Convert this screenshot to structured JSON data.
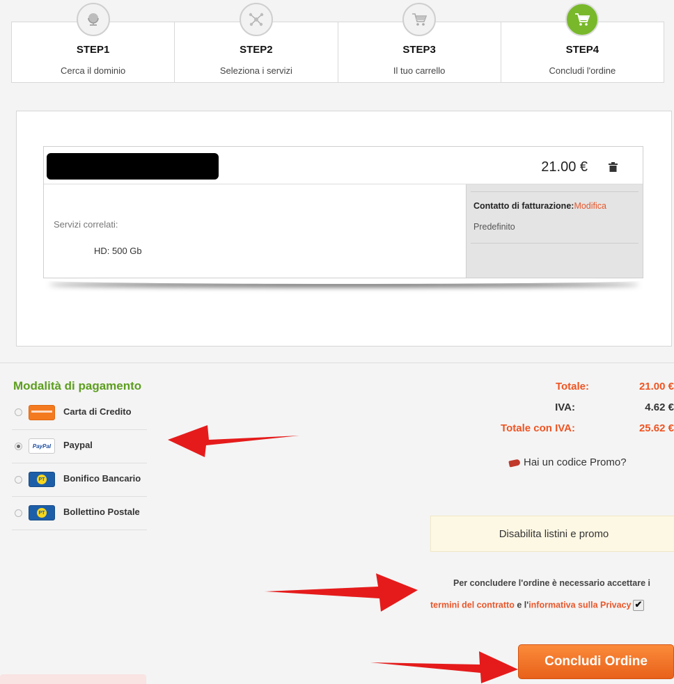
{
  "steps": [
    {
      "title": "STEP1",
      "subtitle": "Cerca il dominio",
      "icon": "globe-icon",
      "active": false
    },
    {
      "title": "STEP2",
      "subtitle": "Seleziona i servizi",
      "icon": "network-icon",
      "active": false
    },
    {
      "title": "STEP3",
      "subtitle": "Il tuo carrello",
      "icon": "cart-icon",
      "active": false
    },
    {
      "title": "STEP4",
      "subtitle": "Concludi l'ordine",
      "icon": "cart-icon",
      "active": true
    }
  ],
  "cart": {
    "price": "21.00 €",
    "services_label": "Servizi correlati:",
    "service_value": "HD: 500 Gb",
    "billing_label": "Contatto di fatturazione:",
    "billing_link": "Modifica",
    "billing_value": "Predefinito"
  },
  "payment": {
    "title": "Modalità di pagamento",
    "methods": [
      {
        "label": "Carta di Credito",
        "icon": "credit-card-icon",
        "selected": false
      },
      {
        "label": "Paypal",
        "icon": "paypal-icon",
        "icon_text": "PayPal",
        "selected": true
      },
      {
        "label": "Bonifico Bancario",
        "icon": "poste-italiane-icon",
        "icon_text": "PT",
        "selected": false
      },
      {
        "label": "Bollettino Postale",
        "icon": "poste-italiane-icon",
        "icon_text": "PT",
        "selected": false
      }
    ]
  },
  "totals": {
    "total_label": "Totale:",
    "total_value": "21.00 €",
    "vat_label": "IVA:",
    "vat_value": "4.62 €",
    "total_vat_label": "Totale con IVA:",
    "total_vat_value": "25.62 €"
  },
  "promo_text": "Hai un codice Promo?",
  "disable_label": "Disabilita listini e promo",
  "terms": {
    "line1": "Per concludere l'ordine è necessario accettare i",
    "link1": "termini del contratto",
    "connector": " e l'",
    "link2": "informativa sulla Privacy",
    "accepted": true
  },
  "submit_label": "Concludi Ordine",
  "colors": {
    "accent_green": "#5c9e1e",
    "accent_orange": "#ee5422",
    "button_orange": "#f37321"
  }
}
